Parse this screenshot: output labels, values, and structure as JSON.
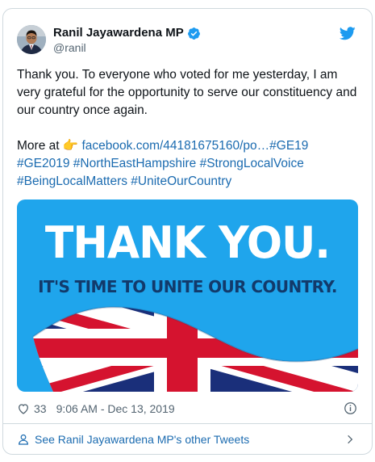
{
  "author": {
    "display_name": "Ranil Jayawardena MP",
    "handle": "@ranil",
    "verified": true
  },
  "tweet": {
    "line1": "Thank you. To everyone who voted for me yesterday, I am very grateful for the opportunity to serve our constituency and our country once again.",
    "more_prefix": "More at ",
    "emoji": "👉",
    "link_text": "facebook.com/44181675160/po…",
    "hashtags": "#GE19 #GE2019 #NorthEastHampshire #StrongLocalVoice #BeingLocalMatters #UniteOurCountry"
  },
  "media": {
    "title": "THANK YOU.",
    "subtitle": "IT'S TIME TO UNITE OUR COUNTRY.",
    "background_color": "#1fa5ec"
  },
  "meta": {
    "like_count": "33",
    "timestamp": "9:06 AM - Dec 13, 2019"
  },
  "footer": {
    "label": "See Ranil Jayawardena MP's other Tweets"
  },
  "colors": {
    "link": "#1b6bb0",
    "twitter_blue": "#1d9bf0"
  },
  "icons": [
    "verified-badge-icon",
    "twitter-bird-icon",
    "heart-icon",
    "info-icon",
    "person-icon",
    "chevron-right-icon"
  ]
}
